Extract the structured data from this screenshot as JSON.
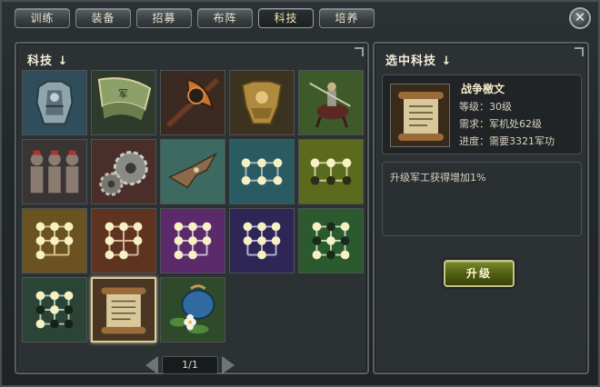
{
  "tabs": [
    {
      "label": "训练",
      "active": false
    },
    {
      "label": "装备",
      "active": false
    },
    {
      "label": "招募",
      "active": false
    },
    {
      "label": "布阵",
      "active": false
    },
    {
      "label": "科技",
      "active": true
    },
    {
      "label": "培养",
      "active": false
    }
  ],
  "close_icon": "close-icon",
  "left_panel": {
    "title": "科技 ↓",
    "grid": [
      {
        "icon": "armor-icon"
      },
      {
        "icon": "war-banner-icon"
      },
      {
        "icon": "axe-icon"
      },
      {
        "icon": "golden-armor-icon"
      },
      {
        "icon": "cavalry-icon"
      },
      {
        "icon": "soldiers-icon"
      },
      {
        "icon": "gears-icon"
      },
      {
        "icon": "eagle-icon"
      },
      {
        "icon": "formation-grid-icon"
      },
      {
        "icon": "formation-grid-icon"
      },
      {
        "icon": "formation-grid-icon"
      },
      {
        "icon": "formation-grid-icon"
      },
      {
        "icon": "formation-grid-icon"
      },
      {
        "icon": "formation-grid-icon"
      },
      {
        "icon": "formation-grid-icon"
      },
      {
        "icon": "formation-grid-icon"
      },
      {
        "icon": "scroll-icon",
        "selected": true
      },
      {
        "icon": "herb-bag-icon"
      }
    ],
    "pager": {
      "label": "1/1"
    }
  },
  "right_panel": {
    "title": "选中科技 ↓",
    "item": {
      "name": "战争檄文",
      "level": "等级：30级",
      "requirement": "需求：军机处62级",
      "progress": "进度：需要3321军功"
    },
    "description": "升级军工获得增加1%",
    "upgrade_label": "升级"
  },
  "colors": {
    "accent_gold": "#d8cfa0",
    "button_green": "#5a6614",
    "panel_bg": "#2c3133"
  }
}
